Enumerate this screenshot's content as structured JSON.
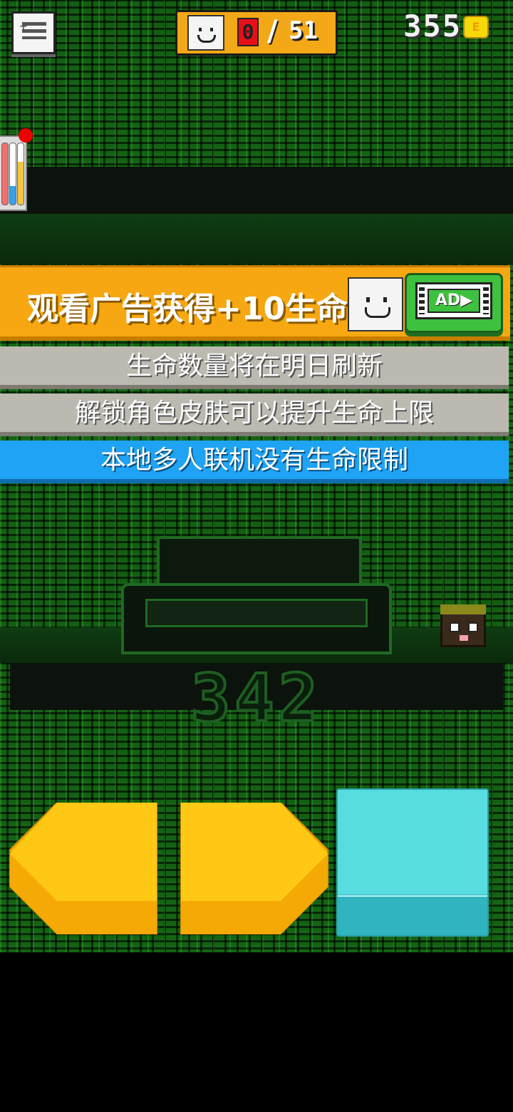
{
  "hud": {
    "lives_current": "0",
    "lives_separator": "/",
    "lives_max": "51",
    "coins": "355",
    "coin_symbol": "E"
  },
  "ad_banner": {
    "text": "观看广告获得+10生命",
    "button_label": "AD▶"
  },
  "info": {
    "refresh_notice": "生命数量将在明日刷新",
    "unlock_notice": "解锁角色皮肤可以提升生命上限",
    "multiplayer_notice": "本地多人联机没有生命限制"
  },
  "game": {
    "score": "342"
  },
  "colors": {
    "accent_orange": "#f7a711",
    "info_gray": "#bcbab0",
    "info_blue": "#1fa3f5",
    "matrix_green": "#0d4d0d",
    "jump_cyan": "#57dde0",
    "move_yellow": "#ffc20e"
  },
  "icons": {
    "menu": "menu-icon",
    "face": "smiley-face-icon",
    "coin": "coin-icon",
    "ad_video": "video-ad-icon"
  }
}
